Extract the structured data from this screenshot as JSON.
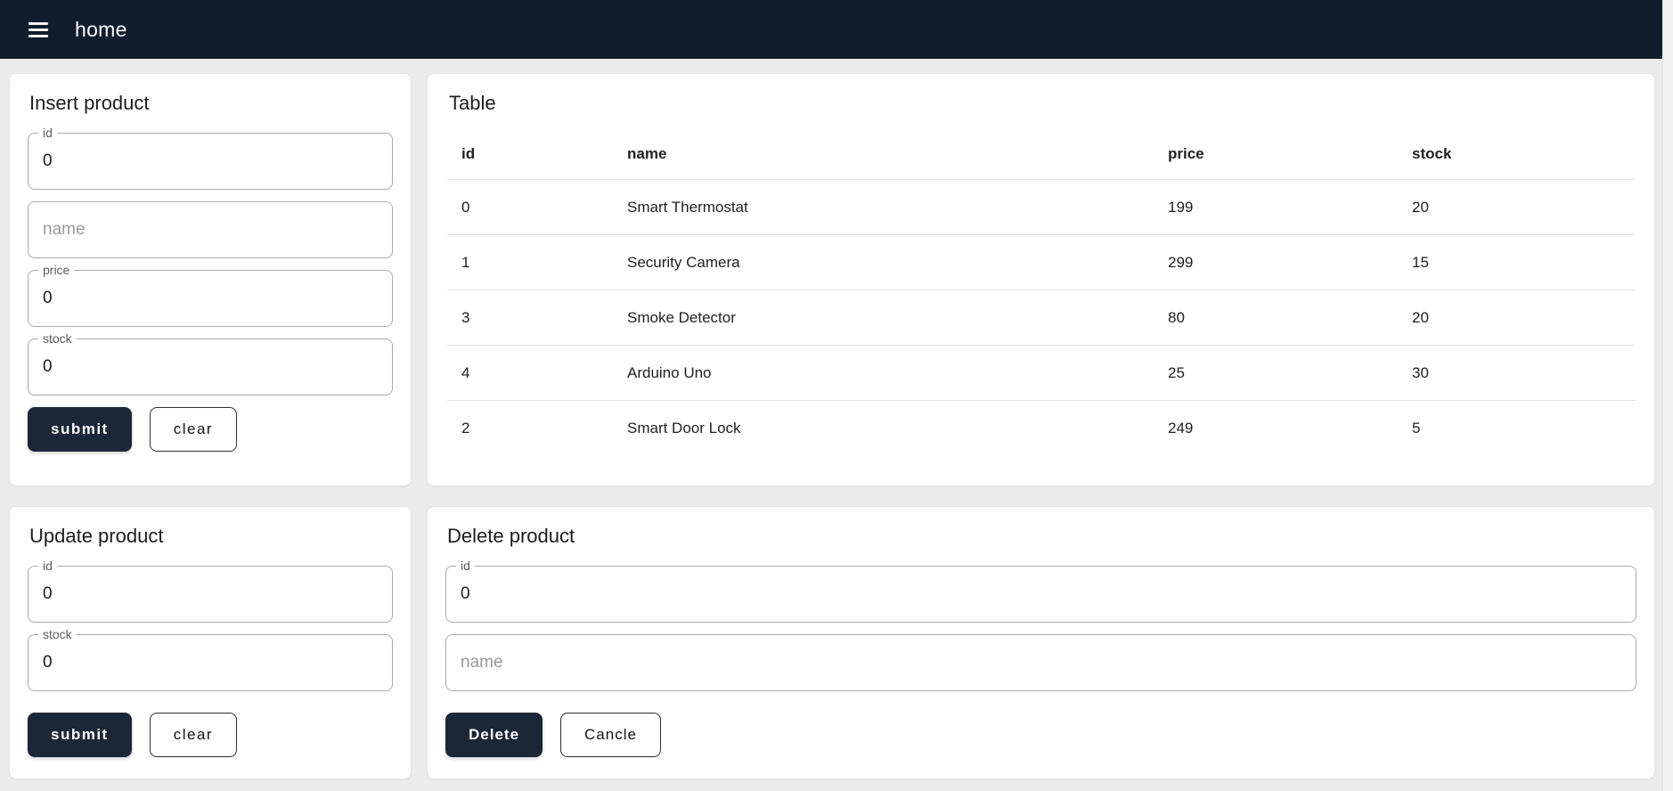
{
  "navbar": {
    "title": "home",
    "menu_icon": "hamburger-icon"
  },
  "colors": {
    "navbar": "#111d2c",
    "button_dark": "#1b2737",
    "background": "#ececec"
  },
  "insert_card": {
    "title": "Insert product",
    "fields": [
      {
        "label": "id",
        "value": "0"
      },
      {
        "label": "name",
        "placeholder": "name",
        "value": ""
      },
      {
        "label": "price",
        "value": "0"
      },
      {
        "label": "stock",
        "value": "0"
      }
    ],
    "submit_label": "submit",
    "clear_label": "clear"
  },
  "table_card": {
    "title": "Table",
    "columns": [
      "id",
      "name",
      "price",
      "stock"
    ],
    "rows": [
      [
        "0",
        "Smart Thermostat",
        "199",
        "20"
      ],
      [
        "1",
        "Security Camera",
        "299",
        "15"
      ],
      [
        "3",
        "Smoke Detector",
        "80",
        "20"
      ],
      [
        "4",
        "Arduino Uno",
        "25",
        "30"
      ],
      [
        "2",
        "Smart Door Lock",
        "249",
        "5"
      ]
    ]
  },
  "update_card": {
    "title": "Update product",
    "fields": [
      {
        "label": "id",
        "value": "0"
      },
      {
        "label": "stock",
        "value": "0"
      }
    ],
    "submit_label": "submit",
    "clear_label": "clear"
  },
  "delete_card": {
    "title": "Delete product",
    "id_field": {
      "label": "id",
      "value": "0"
    },
    "name_field": {
      "placeholder": "name",
      "value": ""
    },
    "delete_label": "Delete",
    "cancel_label": "Cancle"
  }
}
